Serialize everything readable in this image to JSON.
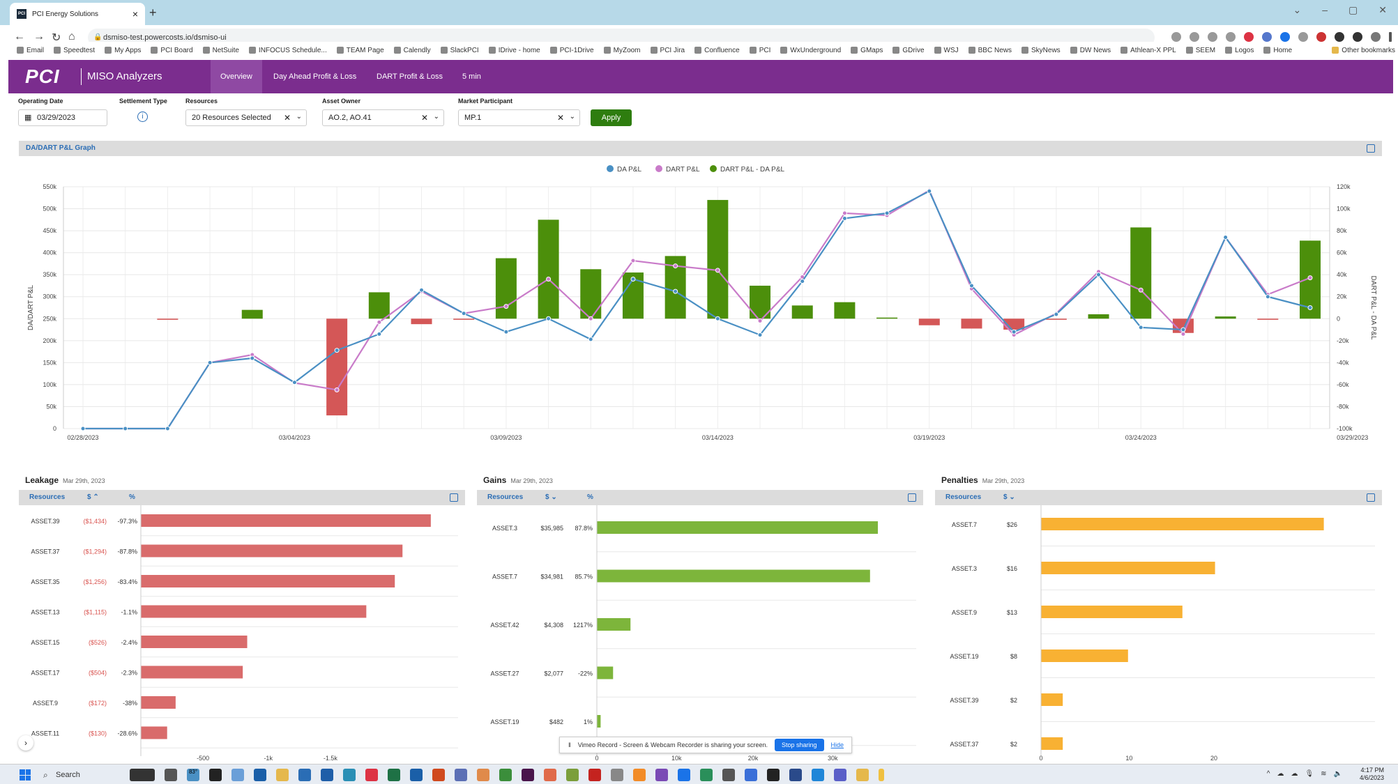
{
  "browser": {
    "tab_title": "PCI Energy Solutions",
    "tab_favicon": "PCI",
    "url": "dsmiso-test.powercosts.io/dsmiso-ui",
    "bookmarks": [
      "Email",
      "Speedtest",
      "My Apps",
      "PCI Board",
      "NetSuite",
      "INFOCUS Schedule...",
      "TEAM Page",
      "Calendly",
      "SlackPCI",
      "IDrive - home",
      "PCI-1Drive",
      "MyZoom",
      "PCI Jira",
      "Confluence",
      "PCI",
      "WxUnderground",
      "GMaps",
      "GDrive",
      "WSJ",
      "BBC News",
      "SkyNews",
      "DW News",
      "Athlean-X PPL",
      "SEEM",
      "Logos",
      "Home"
    ],
    "other_bookmarks": "Other bookmarks"
  },
  "app": {
    "logo": "PCI",
    "name": "MISO Analyzers",
    "nav": [
      "Overview",
      "Day Ahead Profit & Loss",
      "DART Profit & Loss",
      "5 min"
    ],
    "accent": "#7b2d8e"
  },
  "filters": {
    "operating_date_label": "Operating Date",
    "operating_date": "03/29/2023",
    "settlement_type_label": "Settlement Type",
    "resources_label": "Resources",
    "resources": "20 Resources Selected",
    "asset_owner_label": "Asset Owner",
    "asset_owner": "AO.2, AO.41",
    "market_participant_label": "Market Participant",
    "market_participant": "MP.1",
    "apply": "Apply"
  },
  "main_chart": {
    "panel_title": "DA/DART P&L Graph",
    "legend": [
      "DA P&L",
      "DART P&L",
      "DART P&L - DA P&L"
    ],
    "y_left_label": "DA/DART P&L",
    "y_right_label": "DART P&L - DA P&L",
    "y_left_ticks": [
      "0",
      "50k",
      "100k",
      "150k",
      "200k",
      "250k",
      "300k",
      "350k",
      "400k",
      "450k",
      "500k",
      "550k"
    ],
    "y_right_ticks": [
      "-100k",
      "-80k",
      "-60k",
      "-40k",
      "-20k",
      "0",
      "20k",
      "40k",
      "60k",
      "80k",
      "100k",
      "120k"
    ],
    "x_ticks": [
      "02/28/2023",
      "03/04/2023",
      "03/09/2023",
      "03/14/2023",
      "03/19/2023",
      "03/24/2023",
      "03/29/2023"
    ]
  },
  "leakage": {
    "title": "Leakage",
    "date": "Mar 29th, 2023",
    "cols": [
      "Resources",
      "$",
      "%"
    ],
    "rows": [
      {
        "name": "ASSET.39",
        "amount": "($1,434)",
        "pct": "-97.3%"
      },
      {
        "name": "ASSET.37",
        "amount": "($1,294)",
        "pct": "-87.8%"
      },
      {
        "name": "ASSET.35",
        "amount": "($1,256)",
        "pct": "-83.4%"
      },
      {
        "name": "ASSET.13",
        "amount": "($1,115)",
        "pct": "-1.1%"
      },
      {
        "name": "ASSET.15",
        "amount": "($526)",
        "pct": "-2.4%"
      },
      {
        "name": "ASSET.17",
        "amount": "($504)",
        "pct": "-2.3%"
      },
      {
        "name": "ASSET.9",
        "amount": "($172)",
        "pct": "-38%"
      },
      {
        "name": "ASSET.11",
        "amount": "($130)",
        "pct": "-28.6%"
      }
    ],
    "axis_ticks": [
      "-500",
      "-1k",
      "-1.5k"
    ]
  },
  "gains": {
    "title": "Gains",
    "date": "Mar 29th, 2023",
    "cols": [
      "Resources",
      "$",
      "%"
    ],
    "rows": [
      {
        "name": "ASSET.3",
        "amount": "$35,985",
        "pct": "87.8%"
      },
      {
        "name": "ASSET.7",
        "amount": "$34,981",
        "pct": "85.7%"
      },
      {
        "name": "ASSET.42",
        "amount": "$4,308",
        "pct": "1217%"
      },
      {
        "name": "ASSET.27",
        "amount": "$2,077",
        "pct": "-22%"
      },
      {
        "name": "ASSET.19",
        "amount": "$482",
        "pct": "1%"
      }
    ],
    "axis_ticks": [
      "0",
      "10k",
      "20k",
      "30k"
    ]
  },
  "penalties": {
    "title": "Penalties",
    "date": "Mar 29th, 2023",
    "cols": [
      "Resources",
      "$"
    ],
    "rows": [
      {
        "name": "ASSET.7",
        "amount": "$26"
      },
      {
        "name": "ASSET.3",
        "amount": "$16"
      },
      {
        "name": "ASSET.9",
        "amount": "$13"
      },
      {
        "name": "ASSET.19",
        "amount": "$8"
      },
      {
        "name": "ASSET.39",
        "amount": "$2"
      },
      {
        "name": "ASSET.37",
        "amount": "$2"
      }
    ],
    "axis_ticks": [
      "0",
      "10",
      "20"
    ]
  },
  "vimeo": {
    "text": "Vimeo Record - Screen & Webcam Recorder is sharing your screen.",
    "stop": "Stop sharing",
    "hide": "Hide"
  },
  "taskbar": {
    "search": "Search",
    "weather": "83°",
    "time": "4:17 PM",
    "date": "4/6/2023"
  },
  "chart_data": [
    {
      "type": "line",
      "x": [
        "02/28/2023",
        "03/01/2023",
        "03/02/2023",
        "03/03/2023",
        "03/04/2023",
        "03/05/2023",
        "03/06/2023",
        "03/07/2023",
        "03/08/2023",
        "03/09/2023",
        "03/10/2023",
        "03/11/2023",
        "03/12/2023",
        "03/13/2023",
        "03/14/2023",
        "03/15/2023",
        "03/16/2023",
        "03/17/2023",
        "03/18/2023",
        "03/19/2023",
        "03/20/2023",
        "03/21/2023",
        "03/22/2023",
        "03/23/2023",
        "03/24/2023",
        "03/25/2023",
        "03/26/2023",
        "03/27/2023",
        "03/28/2023",
        "03/29/2023"
      ],
      "series": [
        {
          "name": "DA P&L",
          "axis": "left",
          "color": "#4a90c4",
          "values": [
            0,
            0,
            0,
            150000,
            160000,
            105000,
            178000,
            215000,
            315000,
            262000,
            220000,
            250000,
            203000,
            340000,
            312000,
            250000,
            213000,
            335000,
            478000,
            490000,
            540000,
            325000,
            220000,
            260000,
            350000,
            230000,
            225000,
            435000,
            300000,
            275000
          ]
        },
        {
          "name": "DART P&L",
          "axis": "left",
          "color": "#c97bc9",
          "values": [
            0,
            0,
            0,
            150000,
            168000,
            104000,
            88000,
            242000,
            312000,
            262000,
            278000,
            340000,
            250000,
            382000,
            370000,
            360000,
            245000,
            345000,
            490000,
            485000,
            542000,
            318000,
            213000,
            262000,
            357000,
            315000,
            215000,
            435000,
            305000,
            343000
          ]
        },
        {
          "name": "DART P&L - DA P&L",
          "axis": "right",
          "type": "bar",
          "color": "#4c8f0b",
          "negative_color": "#d45757",
          "values": [
            0,
            0,
            -1000,
            0,
            8000,
            0,
            -88000,
            24000,
            -5000,
            -1000,
            55000,
            90000,
            45000,
            42000,
            57000,
            108000,
            30000,
            12000,
            15000,
            1000,
            -6000,
            -9000,
            -10000,
            -1000,
            4000,
            83000,
            -13000,
            2000,
            -1000,
            71000
          ]
        }
      ],
      "ylim": [
        0,
        550000
      ],
      "ylim_right": [
        -100000,
        120000
      ],
      "grid": true,
      "legend": "top-center"
    },
    {
      "type": "bar",
      "title": "Leakage",
      "categories": [
        "ASSET.39",
        "ASSET.37",
        "ASSET.35",
        "ASSET.13",
        "ASSET.15",
        "ASSET.17",
        "ASSET.9",
        "ASSET.11"
      ],
      "values": [
        -1434,
        -1294,
        -1256,
        -1115,
        -526,
        -504,
        -172,
        -130
      ],
      "color": "#d96b6b"
    },
    {
      "type": "bar",
      "title": "Gains",
      "categories": [
        "ASSET.3",
        "ASSET.7",
        "ASSET.42",
        "ASSET.27",
        "ASSET.19"
      ],
      "values": [
        35985,
        34981,
        4308,
        2077,
        482
      ],
      "color": "#7db53b"
    },
    {
      "type": "bar",
      "title": "Penalties",
      "categories": [
        "ASSET.7",
        "ASSET.3",
        "ASSET.9",
        "ASSET.19",
        "ASSET.39",
        "ASSET.37"
      ],
      "values": [
        26,
        16,
        13,
        8,
        2,
        2
      ],
      "color": "#f8b133"
    }
  ]
}
